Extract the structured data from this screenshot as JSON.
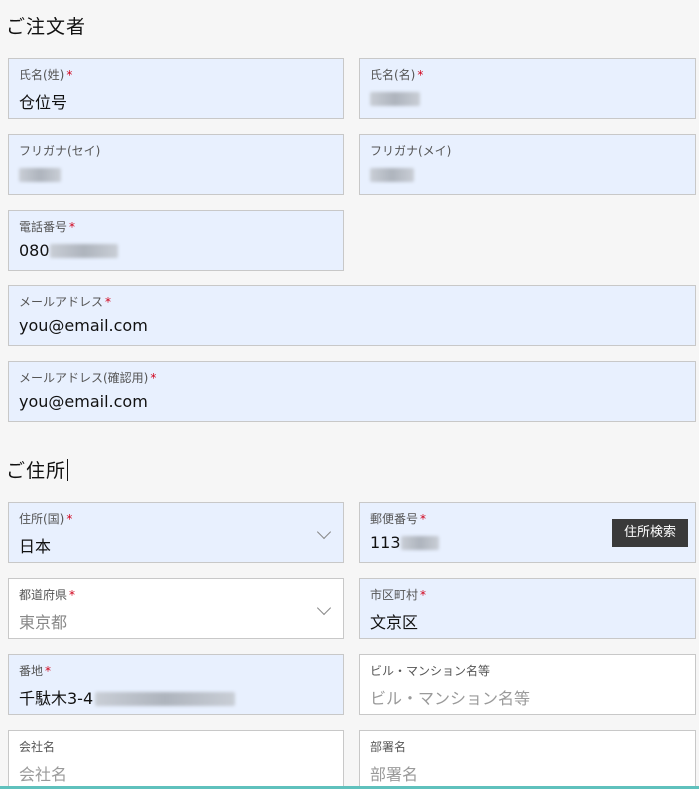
{
  "orderer_section": {
    "title": "ご注文者",
    "last_name": {
      "label": "氏名(姓)",
      "required": "*",
      "value": "仓位号"
    },
    "first_name": {
      "label": "氏名(名)",
      "required": "*",
      "value": ""
    },
    "kana_last": {
      "label": "フリガナ(セイ)",
      "value": ""
    },
    "kana_first": {
      "label": "フリガナ(メイ)",
      "value": ""
    },
    "phone": {
      "label": "電話番号",
      "required": "*",
      "value": "080"
    },
    "email": {
      "label": "メールアドレス",
      "required": "*",
      "value": "you@email.com"
    },
    "email_confirm": {
      "label": "メールアドレス(確認用)",
      "required": "*",
      "value": "you@email.com"
    }
  },
  "address_section": {
    "title": "ご住所",
    "country": {
      "label": "住所(国)",
      "required": "*",
      "value": "日本"
    },
    "postal": {
      "label": "郵便番号",
      "required": "*",
      "value": "113",
      "search_button": "住所検索"
    },
    "prefecture": {
      "label": "都道府県",
      "required": "*",
      "value": "東京都"
    },
    "city": {
      "label": "市区町村",
      "required": "*",
      "value": "文京区"
    },
    "street": {
      "label": "番地",
      "required": "*",
      "value": "千駄木3-4"
    },
    "building": {
      "label": "ビル・マンション名等",
      "placeholder": "ビル・マンション名等"
    },
    "company": {
      "label": "会社名",
      "placeholder": "会社名"
    },
    "department": {
      "label": "部署名",
      "placeholder": "部署名"
    }
  }
}
